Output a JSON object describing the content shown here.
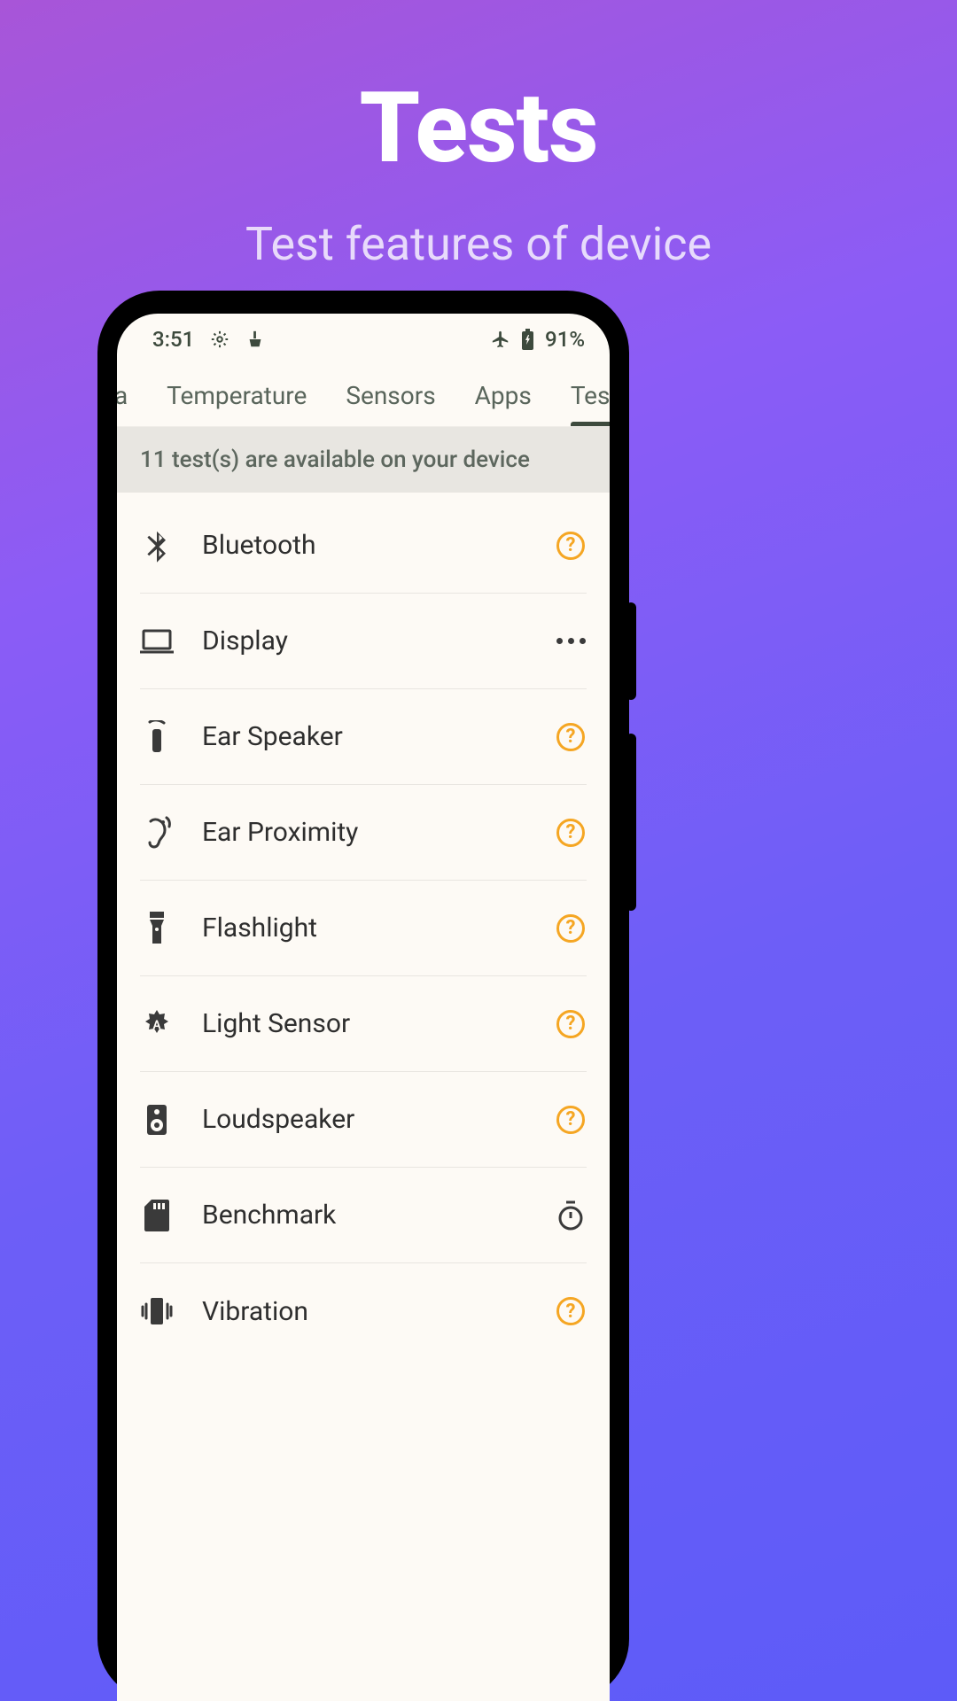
{
  "hero": {
    "title": "Tests",
    "subtitle": "Test features of device"
  },
  "status_bar": {
    "time": "3:51",
    "battery_text": "91%"
  },
  "tabs": [
    {
      "label": "ra",
      "active": false
    },
    {
      "label": "Temperature",
      "active": false
    },
    {
      "label": "Sensors",
      "active": false
    },
    {
      "label": "Apps",
      "active": false
    },
    {
      "label": "Tests",
      "active": true
    }
  ],
  "banner": {
    "text": "11 test(s) are available on your device"
  },
  "tests": [
    {
      "label": "Bluetooth",
      "icon": "bluetooth",
      "action": "help"
    },
    {
      "label": "Display",
      "icon": "laptop",
      "action": "more"
    },
    {
      "label": "Ear Speaker",
      "icon": "ear-speaker",
      "action": "help"
    },
    {
      "label": "Ear Proximity",
      "icon": "ear-proximity",
      "action": "help"
    },
    {
      "label": "Flashlight",
      "icon": "flashlight",
      "action": "help"
    },
    {
      "label": "Light Sensor",
      "icon": "light-sensor",
      "action": "help"
    },
    {
      "label": "Loudspeaker",
      "icon": "loudspeaker",
      "action": "help"
    },
    {
      "label": "Benchmark",
      "icon": "sd-card",
      "action": "timer"
    },
    {
      "label": "Vibration",
      "icon": "vibration",
      "action": "help"
    }
  ]
}
